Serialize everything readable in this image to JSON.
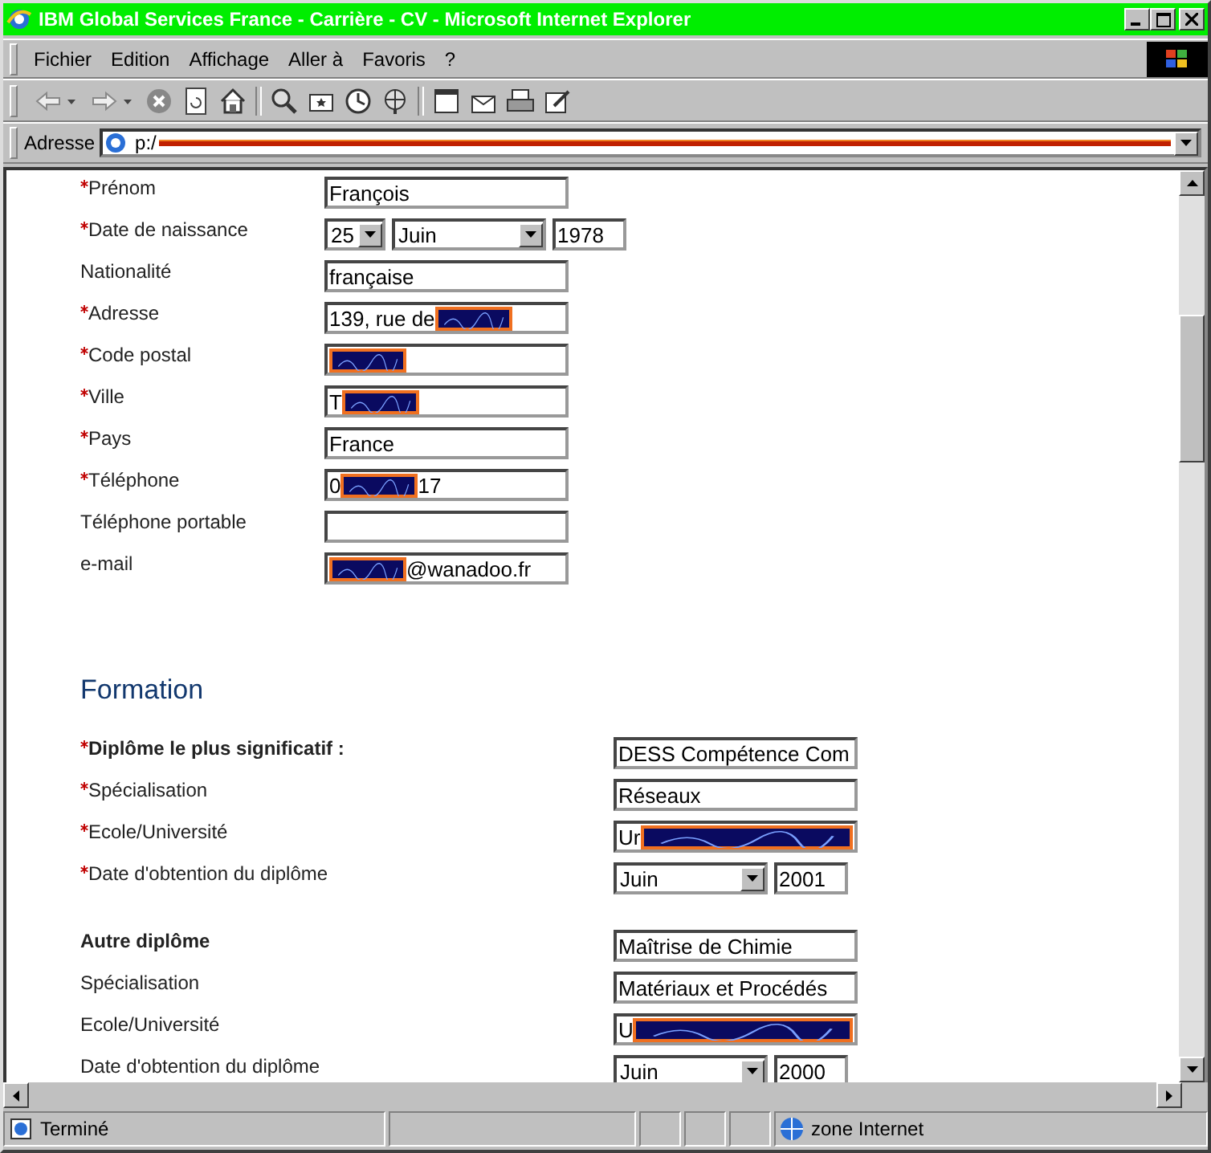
{
  "window": {
    "title": "IBM Global Services France - Carrière - CV - Microsoft Internet Explorer"
  },
  "menu": [
    {
      "label": "Fichier"
    },
    {
      "label": "Edition"
    },
    {
      "label": "Affichage"
    },
    {
      "label": "Aller à"
    },
    {
      "label": "Favoris"
    },
    {
      "label": "?"
    }
  ],
  "address": {
    "label": "Adresse",
    "value": "p:/",
    "redacted": true
  },
  "personal": [
    {
      "kind": "text",
      "required": true,
      "label": "Prénom",
      "value": "François"
    },
    {
      "kind": "date",
      "required": true,
      "label": "Date de naissance",
      "day": "25",
      "month": "Juin",
      "year": "1978"
    },
    {
      "kind": "text",
      "required": false,
      "label": "Nationalité",
      "value": "française"
    },
    {
      "kind": "text",
      "required": true,
      "label": "Adresse",
      "value": "139, rue de",
      "redacted": true
    },
    {
      "kind": "text",
      "required": true,
      "label": "Code postal",
      "redacted": true
    },
    {
      "kind": "text",
      "required": true,
      "label": "Ville",
      "value": "T",
      "redacted": true
    },
    {
      "kind": "text",
      "required": true,
      "label": "Pays",
      "value": "France"
    },
    {
      "kind": "text",
      "required": true,
      "label": "Téléphone",
      "value": "0",
      "redacted": true,
      "value_after": "17"
    },
    {
      "kind": "text",
      "required": false,
      "label": "Téléphone portable"
    },
    {
      "kind": "text",
      "required": false,
      "label": "e-mail",
      "redacted": true,
      "value_after": "@wanadoo.fr"
    }
  ],
  "formation": {
    "heading": "Formation",
    "groups": [
      {
        "rows": [
          {
            "kind": "text",
            "required": true,
            "bold": true,
            "label": "Diplôme le plus significatif :",
            "value": "DESS Compétence Com"
          },
          {
            "kind": "text",
            "required": true,
            "bold": false,
            "label": "Spécialisation",
            "value": "Réseaux"
          },
          {
            "kind": "text",
            "required": true,
            "bold": false,
            "label": "Ecole/Université",
            "value": "Ur",
            "redacted": true
          },
          {
            "kind": "date",
            "required": true,
            "bold": false,
            "label": "Date d'obtention du diplôme",
            "month": "Juin",
            "year": "2001"
          }
        ]
      },
      {
        "rows": [
          {
            "kind": "text",
            "required": false,
            "bold": true,
            "label": "Autre diplôme",
            "value": "Maîtrise de Chimie"
          },
          {
            "kind": "text",
            "required": false,
            "bold": false,
            "label": "Spécialisation",
            "value": "Matériaux et Procédés"
          },
          {
            "kind": "text",
            "required": false,
            "bold": false,
            "label": "Ecole/Université",
            "value": "U",
            "redacted": true
          },
          {
            "kind": "date",
            "required": false,
            "bold": false,
            "label": "Date d'obtention du diplôme",
            "month": "Juin",
            "year": "2000"
          }
        ]
      }
    ]
  },
  "status_bar": {
    "text": "Terminé",
    "zone": "zone Internet"
  }
}
